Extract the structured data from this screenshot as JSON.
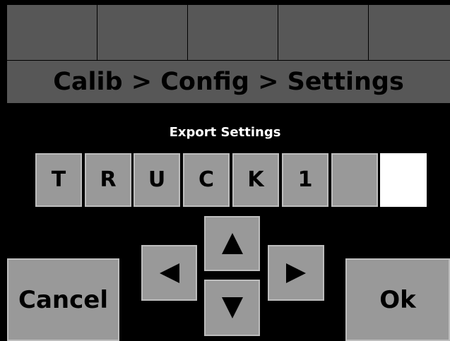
{
  "breadcrumb": "Calib > Config > Settings",
  "dialog_title": "Export Settings",
  "entry": {
    "characters": [
      "T",
      "R",
      "U",
      "C",
      "K",
      "1",
      "",
      ""
    ],
    "active_index": 7
  },
  "buttons": {
    "cancel_label": "Cancel",
    "ok_label": "Ok"
  },
  "icons": {
    "up": "arrow-up-icon",
    "down": "arrow-down-icon",
    "left": "arrow-left-icon",
    "right": "arrow-right-icon"
  },
  "colors": {
    "background": "#000000",
    "panel": "#575757",
    "button": "#999999",
    "button_border": "#bdbdbd",
    "active_cell": "#ffffff",
    "title_text": "#ffffff"
  }
}
